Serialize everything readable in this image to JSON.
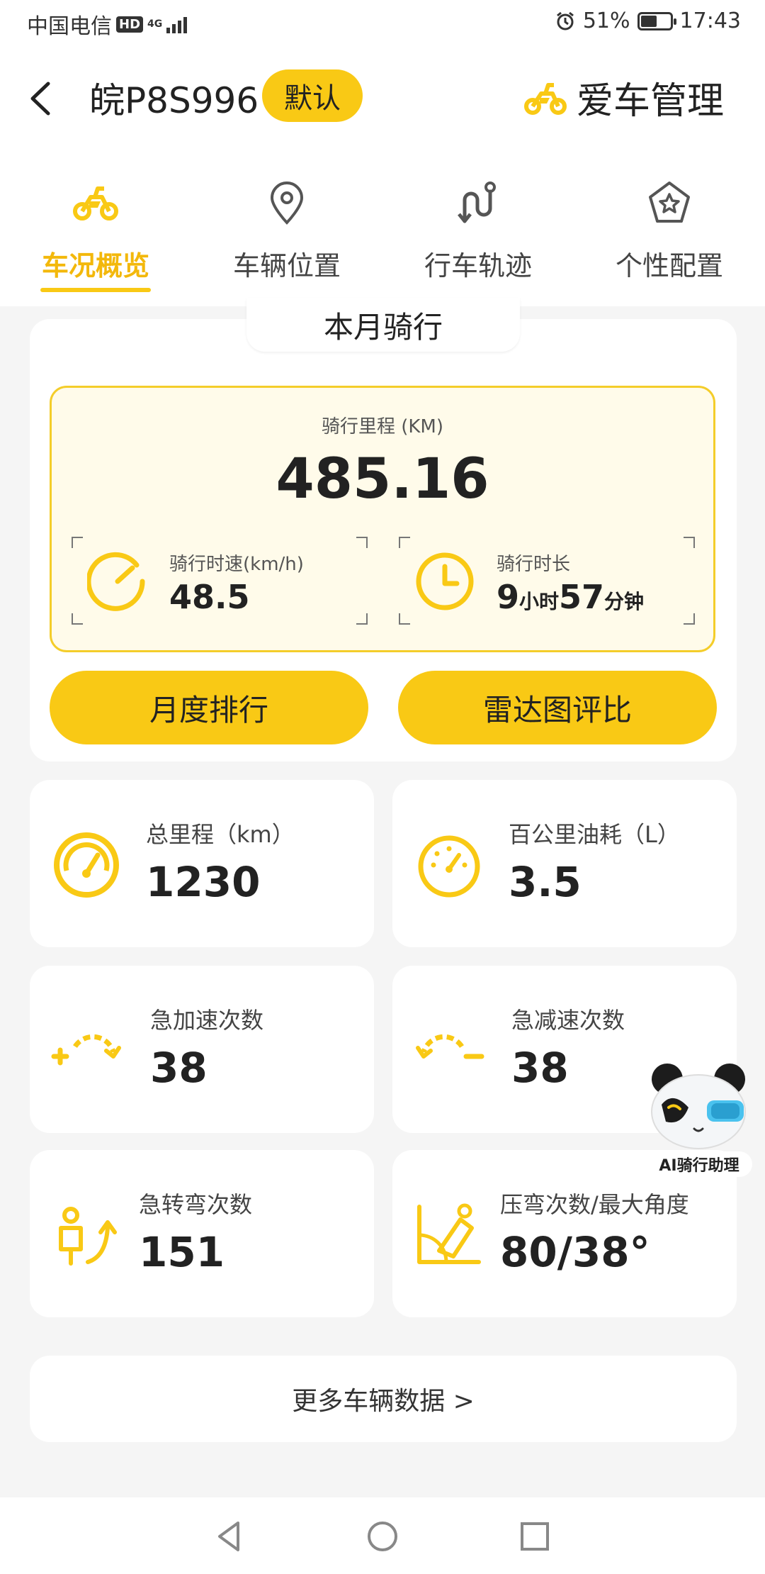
{
  "status_bar": {
    "carrier": "中国电信",
    "hd": "HD",
    "network": "4G",
    "battery": "51%",
    "time": "17:43"
  },
  "header": {
    "plate": "皖P8S996",
    "default_badge": "默认",
    "manage_label": "爱车管理"
  },
  "tabs": [
    {
      "label": "车况概览",
      "icon": "scooter-icon",
      "active": true
    },
    {
      "label": "车辆位置",
      "icon": "location-pin-icon",
      "active": false
    },
    {
      "label": "行车轨迹",
      "icon": "route-icon",
      "active": false
    },
    {
      "label": "个性配置",
      "icon": "star-badge-icon",
      "active": false
    }
  ],
  "monthly": {
    "title": "本月骑行",
    "distance_label": "骑行里程 (KM)",
    "distance_value": "485.16",
    "speed_label": "骑行时速(km/h)",
    "speed_value": "48.5",
    "duration_label": "骑行时长",
    "duration_hours": "9",
    "duration_hours_unit": "小时",
    "duration_minutes": "57",
    "duration_minutes_unit": "分钟",
    "rank_button": "月度排行",
    "radar_button": "雷达图评比"
  },
  "metrics": [
    {
      "label": "总里程（km）",
      "value": "1230",
      "icon": "odometer-icon"
    },
    {
      "label": "百公里油耗（L）",
      "value": "3.5",
      "icon": "fuel-gauge-icon"
    },
    {
      "label": "急加速次数",
      "value": "38",
      "icon": "acceleration-icon"
    },
    {
      "label": "急减速次数",
      "value": "38",
      "icon": "deceleration-icon"
    },
    {
      "label": "急转弯次数",
      "value": "151",
      "icon": "sharp-turn-icon"
    },
    {
      "label": "压弯次数/最大角度",
      "value": "80/38°",
      "icon": "lean-angle-icon"
    }
  ],
  "more_button": "更多车辆数据 >",
  "ai_assistant": {
    "label": "AI骑行助理"
  },
  "colors": {
    "accent": "#f9c915",
    "accent_text": "#f3b80b",
    "panel_bg": "#fffbea",
    "page_bg": "#f5f5f5"
  }
}
